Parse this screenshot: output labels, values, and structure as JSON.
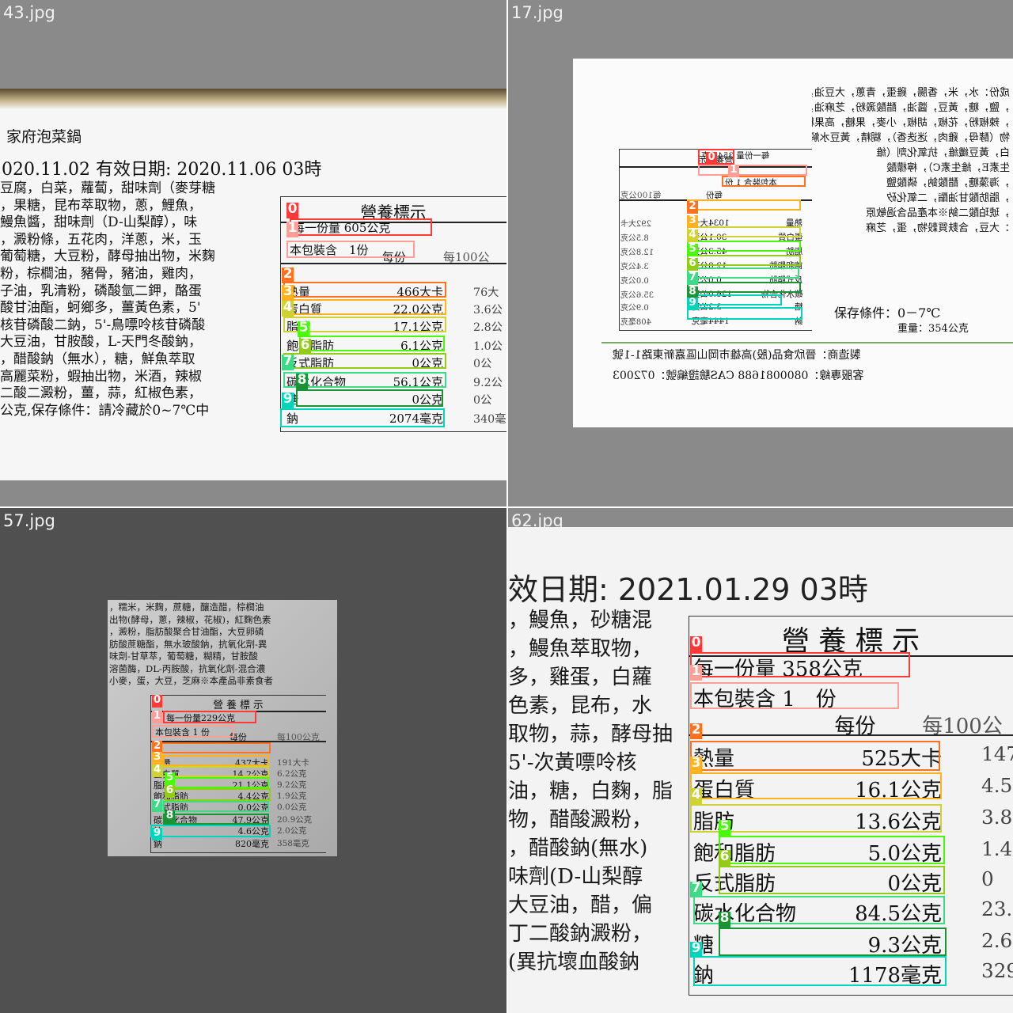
{
  "colors": [
    "#ff3838",
    "#ff9d97",
    "#ff701f",
    "#ffb21d",
    "#cfd231",
    "#48f90a",
    "#92cc17",
    "#3ddb86",
    "#1a9334",
    "#00d4bb"
  ],
  "tiles": [
    {
      "filename": "43.jpg",
      "header": "家府泡菜鍋",
      "date_line": "020.11.02 有效日期: 2020.11.06 03時",
      "ingredients": [
        "豆腐，白菜，蘿蔔，甜味劑（麥芽糖",
        "，果糖，昆布萃取物，蔥，鯉魚，",
        "鰻魚醬，甜味劑（D-山梨醇），味",
        "，澱粉條，五花肉，洋蔥，米，玉",
        "葡萄糖，大豆粉，酵母抽出物，米麴",
        "粉，棕櫚油，豬骨，豬油，雞肉，",
        "子油，乳清粉，磷酸氫二鉀，酪蛋",
        "酸甘油酯，蚵鄉多，薑黃色素，5'",
        "核苷磷酸二鈉，5'-鳥嘌呤核苷磷酸",
        "大豆油，甘胺酸，L-天門冬酸鈉，",
        "，醋酸鈉（無水），糖，鮮魚萃取",
        "高麗菜粉，蝦抽出物，米酒，辣椒",
        "二酸二澱粉，薑，蒜，紅椒色素，",
        "公克,保存條件：請冷藏於0~7℃中"
      ],
      "nutrition_title": "營養標示",
      "serving_size": "每一份量 605公克",
      "servings": "本包裝含　1份",
      "per_serving": "每份",
      "per_100": "每100公",
      "rows": [
        {
          "name": "熱量",
          "value": "466大卡",
          "v100": "76大"
        },
        {
          "name": "蛋白質",
          "value": "22.0公克",
          "v100": "3.6公"
        },
        {
          "name": "脂肪",
          "value": "17.1公克",
          "v100": "2.8公"
        },
        {
          "name": "飽和脂肪",
          "value": "6.1公克",
          "v100": "1.0公"
        },
        {
          "name": "反式脂肪",
          "value": "0公克",
          "v100": "0公"
        },
        {
          "name": "碳水化合物",
          "value": "56.1公克",
          "v100": "9.2公"
        },
        {
          "name": "糖",
          "value": "0公克",
          "v100": "0公"
        },
        {
          "name": "鈉",
          "value": "2074毫克",
          "v100": "340毫"
        }
      ]
    },
    {
      "filename": "17.jpg",
      "ingredients": [
        "成份：水，米，香腸，雞蛋，青蔥，大豆油，豬油，菜籽油，醋",
        "，鹽，糖，黃豆，醬油，醋酸澱粉，芝麻油，紅蘿蔔，蒜，洋蔥",
        "，辣椒粉，花椒，胡椒，小麥，果糖，高果糖糖漿，酒精，抽出",
        "物（酵母，雞肉，迷迭香），糊精，黃豆水解蛋白，小麥發酵蛋",
        "白，黃豆纖維，抗氧化劑（維",
        "生素E，維生素C），檸檬酸",
        "，海藻糖，醋酸鈉，磷酸鹽",
        "，脂肪酸甘油酯，二氧化矽",
        "，琥珀酸二鈉※本產品含過敏原",
        "：大豆，含麩質穀物，蛋，芝麻"
      ],
      "nutrition_title": "營養標示",
      "serving_size": "每一份量 354公克",
      "servings": "本包裝含 1 份",
      "per_serving": "每份",
      "per_100": "每100公克",
      "rows": [
        {
          "name": "熱量",
          "value": "1034大卡",
          "v100": "292大卡"
        },
        {
          "name": "蛋白質",
          "value": "30.1公克",
          "v100": "8.5公克"
        },
        {
          "name": "脂肪",
          "value": "45.3公克",
          "v100": "12.8公克"
        },
        {
          "name": "飽和脂肪",
          "value": "12.0公克",
          "v100": "3.4公克"
        },
        {
          "name": "反式脂肪",
          "value": "0.0公克",
          "v100": "0.0公克"
        },
        {
          "name": "碳水化合物",
          "value": "126.0公克",
          "v100": "35.6公克"
        },
        {
          "name": "糖",
          "value": "3.2公克",
          "v100": "0.9公克"
        },
        {
          "name": "鈉",
          "value": "1444毫克",
          "v100": "408毫克"
        }
      ],
      "storage": "保存條件：0－7℃",
      "weight": "重量：354公克",
      "maker": "製造商：晉欣食品(股)高雄市岡山區嘉新東路1-1號",
      "hotline": "客服專線：0800081688 CAS驗證編號：072003"
    },
    {
      "filename": "57.jpg",
      "ingredients": [
        "，糯米，米麴，蔗糖，釀造醋，棕櫚油",
        "出物(酵母，蔥，辣椒，花椒)，紅麴色素",
        "，澱粉，脂肪酸聚合甘油酯，大豆卵磷",
        "肪酸蔗糖酯，無水玻酸鈉，抗氧化劑-異",
        "味劑-甘草萃，葡萄糖，糊精，甘胺酸",
        "溶菌酶，DL-丙胺酸，抗氧化劑-混合濃",
        "小麥，蛋，大豆，芝麻※本產品非素食者"
      ],
      "nutrition_title": "營 養 標 示",
      "serving_size": "每一份量229公克",
      "servings": "本包裝含 1 份",
      "per_serving": "每份",
      "per_100": "每100公克",
      "rows": [
        {
          "name": "熱量",
          "value": "437大卡",
          "v100": "191大卡"
        },
        {
          "name": "蛋白質",
          "value": "14.2公克",
          "v100": "6.2公克"
        },
        {
          "name": "脂肪",
          "value": "21.1公克",
          "v100": "9.2公克"
        },
        {
          "name": "飽和脂肪",
          "value": "4.4公克",
          "v100": "1.9公克"
        },
        {
          "name": "反式脂肪",
          "value": "0.0公克",
          "v100": "0.0公克"
        },
        {
          "name": "碳水化合物",
          "value": "47.9公克",
          "v100": "20.9公克"
        },
        {
          "name": "糖",
          "value": "4.6公克",
          "v100": "2.0公克"
        },
        {
          "name": "鈉",
          "value": "820毫克",
          "v100": "358毫克"
        }
      ]
    },
    {
      "filename": "62.jpg",
      "date_line": "效日期: 2021.01.29 03時",
      "ingredients": [
        "，鰻魚，砂糖混",
        "，鰻魚萃取物，",
        "多，雞蛋，白蘿",
        "色素，昆布，水",
        "取物，蒜，酵母抽",
        "5'-次黃嘌呤核",
        "油，糖，白麴，脂",
        "物，醋酸澱粉，",
        "，醋酸鈉(無水)",
        "味劑(D-山梨醇",
        "大豆油，醋，偏",
        "丁二酸鈉澱粉，",
        "(異抗壞血酸鈉"
      ],
      "nutrition_title": "營 養 標 示",
      "serving_size": "每一份量 358公克",
      "servings": "本包裝含 1　份",
      "per_serving": "每份",
      "per_100": "每100公",
      "rows": [
        {
          "name": "熱量",
          "value": "525大卡",
          "v100": "147"
        },
        {
          "name": "蛋白質",
          "value": "16.1公克",
          "v100": "4.5"
        },
        {
          "name": "脂肪",
          "value": "13.6公克",
          "v100": "3.8"
        },
        {
          "name": "飽和脂肪",
          "value": "5.0公克",
          "v100": "1.4"
        },
        {
          "name": "反式脂肪",
          "value": "0公克",
          "v100": "0"
        },
        {
          "name": "碳水化合物",
          "value": "84.5公克",
          "v100": "23.6"
        },
        {
          "name": "糖",
          "value": "9.3公克",
          "v100": "2.6"
        },
        {
          "name": "鈉",
          "value": "1178毫克",
          "v100": "329"
        }
      ]
    }
  ]
}
